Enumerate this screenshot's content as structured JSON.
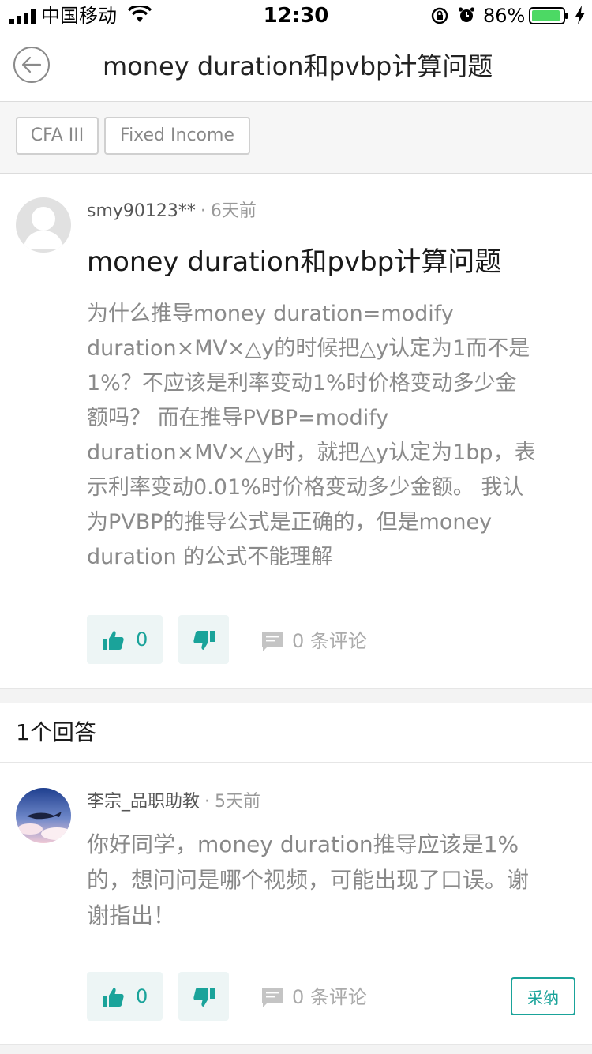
{
  "status": {
    "carrier": "中国移动",
    "time": "12:30",
    "battery_pct": "86%",
    "battery_color": "#4cd964"
  },
  "nav": {
    "title": "money duration和pvbp计算问题",
    "back_icon": "back-arrow-circle-icon"
  },
  "tags": [
    "CFA III",
    "Fixed Income"
  ],
  "question": {
    "author": "smy90123**",
    "time": "6天前",
    "title": "money duration和pvbp计算问题",
    "body": [
      "为什么推导money duration=modify",
      "duration×MV×△y的时候把△y认定为1而不是",
      "1%？不应该是利率变动1%时价格变动多少金",
      "额吗？ 而在推导PVBP=modify",
      "duration×MV×△y时，就把△y认定为1bp，表",
      "示利率变动0.01%时价格变动多少金额。 我认",
      "为PVBP的推导公式是正确的，但是money",
      "duration 的公式不能理解"
    ],
    "likes": "0",
    "comments_count": "0",
    "comments_label": "条评论"
  },
  "answers": {
    "header": "1个回答",
    "items": [
      {
        "author": "李宗_品职助教",
        "time": "5天前",
        "body": [
          "你好同学，money duration推导应该是1%",
          "的，想问问是哪个视频，可能出现了口误。谢",
          "谢指出！"
        ],
        "likes": "0",
        "comments_count": "0",
        "comments_label": "条评论",
        "adopt_label": "采纳"
      }
    ]
  },
  "colors": {
    "accent": "#1aa39a",
    "vote_bg": "#edf5f5",
    "text_muted": "#8a8a8a"
  }
}
